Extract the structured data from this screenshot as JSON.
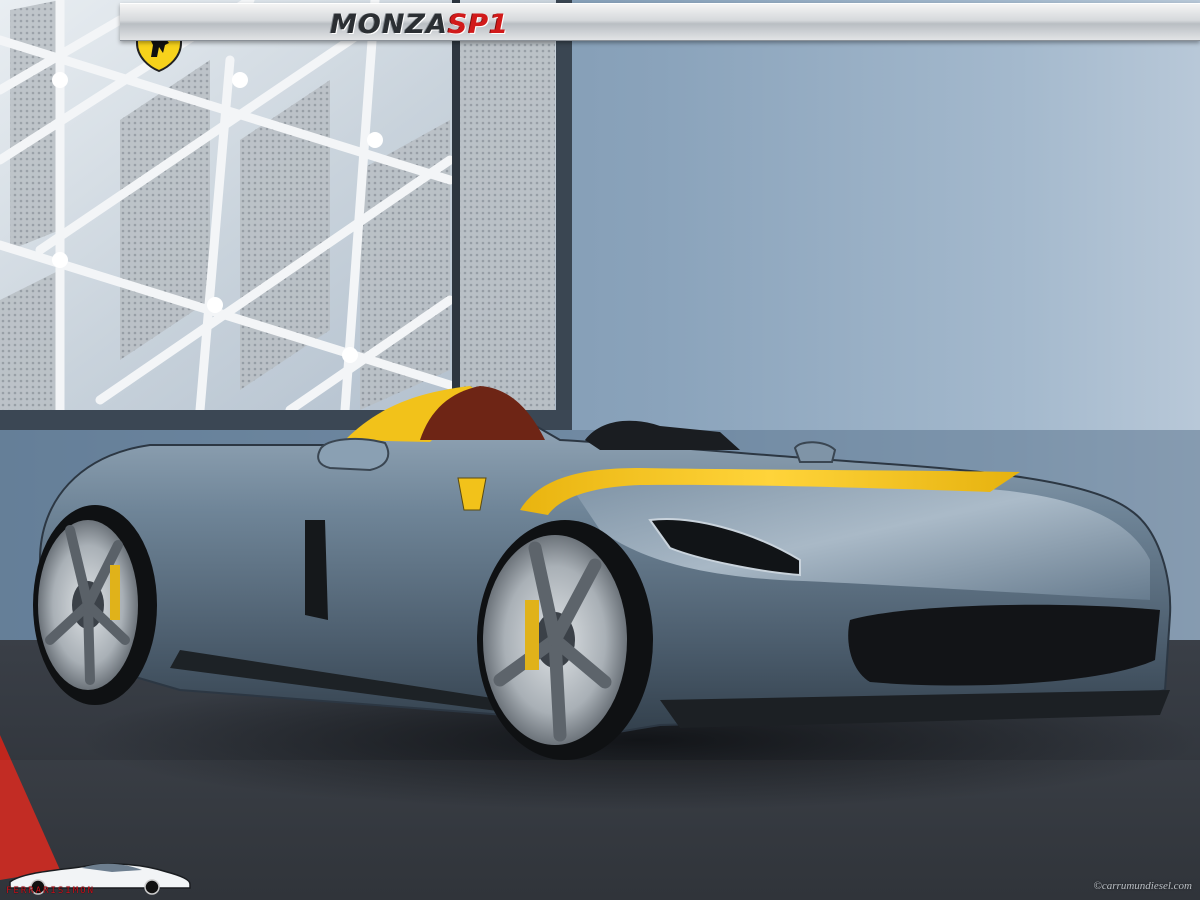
{
  "title": {
    "main": "MONZA",
    "accent": "SP1"
  },
  "logo": {
    "caption": "FERRARISIMON"
  },
  "watermark": "©carrumundiesel.com",
  "colors": {
    "title_accent": "#d11a1a",
    "body_paint": "#5f7488",
    "stripe": "#f2c21a",
    "interior": "#7a2a1a"
  }
}
